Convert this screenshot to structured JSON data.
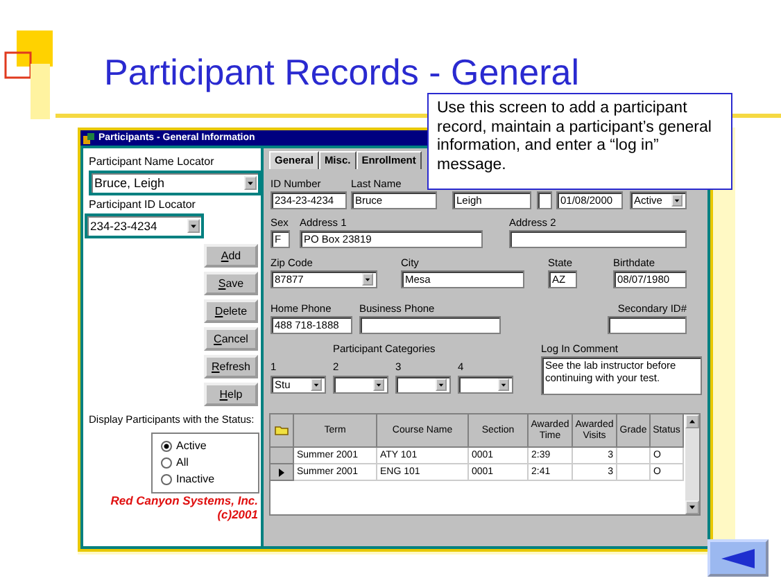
{
  "slide": {
    "title": "Participant Records - General"
  },
  "callout": {
    "text": "Use this screen to add a participant record, maintain a participant’s general information, and enter a “log in” message."
  },
  "window": {
    "title": "Participants - General Information"
  },
  "locators": [
    {
      "label": "Participant Name Locator",
      "value": "Bruce, Leigh"
    },
    {
      "label": "Participant ID Locator",
      "value": "234-23-4234"
    }
  ],
  "buttons": [
    "Add",
    "Save",
    "Delete",
    "Cancel",
    "Refresh",
    "Help"
  ],
  "status_filter": {
    "label": "Display Participants with the Status:",
    "options": [
      {
        "label": "Active",
        "selected": true
      },
      {
        "label": "All",
        "selected": false
      },
      {
        "label": "Inactive",
        "selected": false
      }
    ]
  },
  "company": [
    "Red Canyon Systems, Inc.",
    "(c)2001"
  ],
  "tabs": [
    {
      "label": "General",
      "selected": true
    },
    {
      "label": "Misc.",
      "selected": false
    },
    {
      "label": "Enrollment",
      "selected": false
    }
  ],
  "field_rows": [
    [
      {
        "label": "ID Number",
        "value": "234-23-4234",
        "kind": "text"
      },
      {
        "label": "Last Name",
        "value": "Bruce",
        "kind": "text"
      },
      {
        "value": "Leigh",
        "kind": "text"
      },
      {
        "kind": "text"
      },
      {
        "value": "01/08/2000",
        "kind": "text"
      },
      {
        "value": "Active",
        "kind": "dropdown"
      }
    ],
    [
      {
        "label": "Sex",
        "value": "F",
        "kind": "text"
      },
      {
        "label": "Address 1",
        "value": "PO Box 23819",
        "kind": "text"
      },
      {
        "label": "Address 2",
        "kind": "text"
      }
    ],
    [
      {
        "label": "Zip Code",
        "value": "87877",
        "kind": "dropdown"
      },
      {
        "label": "City",
        "value": "Mesa",
        "kind": "text"
      },
      {
        "label": "State",
        "value": "AZ",
        "kind": "text"
      },
      {
        "label": "Birthdate",
        "value": "08/07/1980",
        "kind": "text"
      }
    ],
    [
      {
        "label": "Home Phone",
        "value": "488 718-1888",
        "kind": "text"
      },
      {
        "label": "Business Phone",
        "kind": "text"
      },
      {
        "label": "Secondary ID#",
        "kind": "text"
      }
    ]
  ],
  "categories": {
    "label": "Participant Categories",
    "items": [
      {
        "number": "1",
        "value": "Stu"
      },
      {
        "number": "2"
      },
      {
        "number": "3"
      },
      {
        "number": "4"
      }
    ]
  },
  "log_in_comment": {
    "label": "Log In Comment",
    "value": "See the lab instructor before continuing with your test."
  },
  "enrollment_grid": {
    "columns": [
      "Term",
      "Course Name",
      "Section",
      "Awarded Time",
      "Awarded Visits",
      "Grade",
      "Status"
    ],
    "rows": [
      {
        "selected": false,
        "cells": [
          "Summer 2001",
          "ATY 101",
          "0001",
          "2:39",
          "3",
          "",
          "O"
        ]
      },
      {
        "selected": true,
        "cells": [
          "Summer 2001",
          "ENG 101",
          "0001",
          "2:41",
          "3",
          "",
          "O"
        ]
      }
    ]
  }
}
